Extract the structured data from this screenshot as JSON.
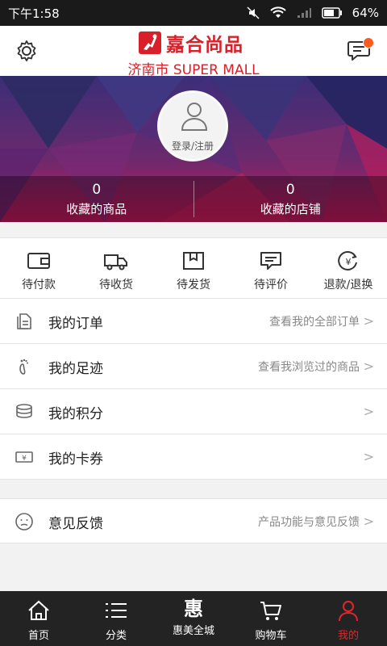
{
  "status_bar": {
    "time": "下午1:58",
    "battery": "64%"
  },
  "header": {
    "logo_text": "嘉合尚品",
    "subtitle": "济南市 SUPER MALL",
    "settings_icon": "gear-icon",
    "message_icon": "chat-bubble-icon",
    "has_notification": true
  },
  "profile": {
    "login_label": "登录/注册",
    "stats": [
      {
        "count": "0",
        "label": "收藏的商品"
      },
      {
        "count": "0",
        "label": "收藏的店铺"
      }
    ]
  },
  "order_status": [
    {
      "label": "待付款",
      "icon": "wallet-icon"
    },
    {
      "label": "待收货",
      "icon": "truck-icon"
    },
    {
      "label": "待发货",
      "icon": "box-icon"
    },
    {
      "label": "待评价",
      "icon": "comment-icon"
    },
    {
      "label": "退款/退换",
      "icon": "refund-icon"
    }
  ],
  "menu": [
    {
      "title": "我的订单",
      "hint": "查看我的全部订单",
      "icon": "document-icon"
    },
    {
      "title": "我的足迹",
      "hint": "查看我浏览过的商品",
      "icon": "footprint-icon"
    },
    {
      "title": "我的积分",
      "hint": "",
      "icon": "coins-icon"
    },
    {
      "title": "我的卡券",
      "hint": "",
      "icon": "coupon-icon"
    }
  ],
  "feedback": {
    "title": "意见反馈",
    "hint": "产品功能与意见反馈",
    "icon": "sad-face-icon"
  },
  "tabbar": [
    {
      "label": "首页",
      "icon": "home-icon",
      "active": false
    },
    {
      "label": "分类",
      "icon": "list-icon",
      "active": false
    },
    {
      "label": "惠美全城",
      "icon": "hui-char",
      "glyph": "惠",
      "active": false
    },
    {
      "label": "购物车",
      "icon": "cart-icon",
      "active": false
    },
    {
      "label": "我的",
      "icon": "user-icon",
      "active": true
    }
  ],
  "colors": {
    "brand_red": "#d8202a",
    "active_tab": "#e0262b",
    "tabbar_bg": "#232323"
  }
}
